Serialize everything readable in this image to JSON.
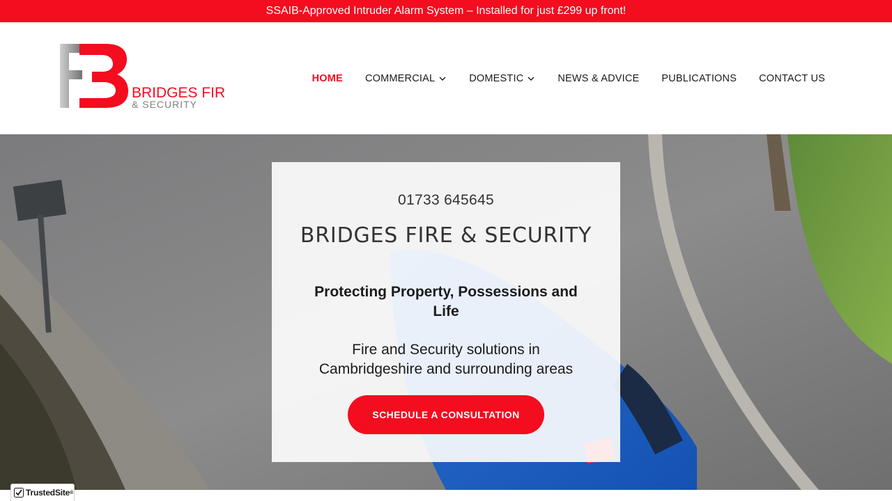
{
  "promo": {
    "text": "SSAIB-Approved Intruder Alarm System – Installed for just £299 up front!"
  },
  "logo": {
    "line1": "BRIDGES FIRE",
    "line2": "& SECURITY"
  },
  "nav": {
    "items": [
      {
        "label": "HOME",
        "active": true
      },
      {
        "label": "COMMERCIAL",
        "dropdown": true
      },
      {
        "label": "DOMESTIC",
        "dropdown": true
      },
      {
        "label": "NEWS & ADVICE"
      },
      {
        "label": "PUBLICATIONS"
      },
      {
        "label": "CONTACT US"
      }
    ]
  },
  "hero": {
    "phone": "01733 645645",
    "title": "BRIDGES FIRE & SECURITY",
    "tagline": "Protecting Property, Possessions and Life",
    "description": "Fire and Security solutions in Cambridgeshire and surrounding areas",
    "cta_label": "SCHEDULE A CONSULTATION"
  },
  "trust_badge": {
    "label": "TrustedSite",
    "mark": "®"
  },
  "colors": {
    "brand_red": "#f40c1f",
    "text_dark": "#1b1b1b",
    "text_gray": "#333333"
  },
  "icons": {
    "dropdown": "chevron-down-icon",
    "trust": "checkmark-icon"
  }
}
